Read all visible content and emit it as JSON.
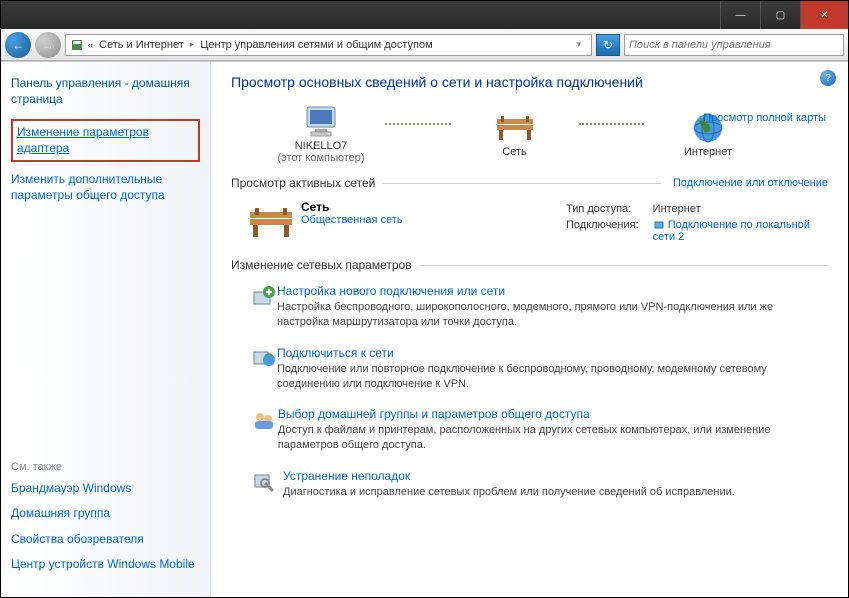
{
  "titlebar": {
    "min": "—",
    "max": "▢",
    "close": "✕"
  },
  "nav": {
    "crumb1": "Сеть и Интернет",
    "crumb2": "Центр управления сетями и общим доступом",
    "search_placeholder": "Поиск в панели управления",
    "back": "←",
    "fwd": "→",
    "refresh": "↻"
  },
  "sidebar": {
    "home": "Панель управления - домашняя страница",
    "link_adapter": "Изменение параметров адаптера",
    "link_sharing": "Изменить дополнительные параметры общего доступа",
    "also": "См. также",
    "also_firewall": "Брандмауэр Windows",
    "also_homegroup": "Домашняя группа",
    "also_internet": "Свойства обозревателя",
    "also_mobile": "Центр устройств Windows Mobile"
  },
  "main": {
    "title": "Просмотр основных сведений о сети и настройка подключений",
    "map_full": "Просмотр полной карты",
    "node_pc": "NIKELLO7",
    "node_pc_sub": "(этот компьютер)",
    "node_net": "Сеть",
    "node_inet": "Интернет",
    "section_active": "Просмотр активных сетей",
    "section_active_link": "Подключение или отключение",
    "net_name": "Сеть",
    "net_type": "Общественная сеть",
    "prop_access_k": "Тип доступа:",
    "prop_access_v": "Интернет",
    "prop_conn_k": "Подключения:",
    "prop_conn_v": "Подключение по локальной сети 2",
    "section_change": "Изменение сетевых параметров",
    "tasks": [
      {
        "link": "Настройка нового подключения или сети",
        "desc": "Настройка беспроводного, широкополосного, модемного, прямого или VPN-подключения или же настройка маршрутизатора или точки доступа."
      },
      {
        "link": "Подключиться к сети",
        "desc": "Подключение или повторное подключение к беспроводному, проводному, модемному сетевому соединению или подключение к VPN."
      },
      {
        "link": "Выбор домашней группы и параметров общего доступа",
        "desc": "Доступ к файлам и принтерам, расположенных на других сетевых компьютерах, или изменение параметров общего доступа."
      },
      {
        "link": "Устранение неполадок",
        "desc": "Диагностика и исправление сетевых проблем или получение сведений об исправлении."
      }
    ]
  }
}
